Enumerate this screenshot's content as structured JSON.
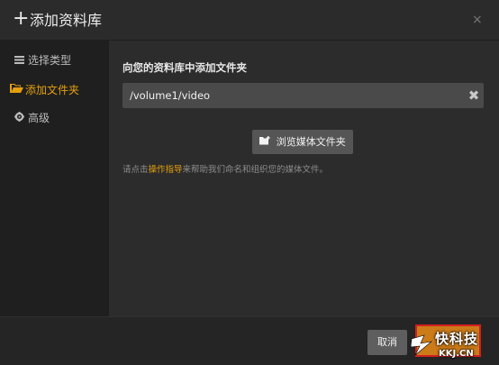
{
  "dialog": {
    "title_icon": "+",
    "title": "添加资料库",
    "close_icon": "×"
  },
  "sidebar": {
    "items": [
      {
        "icon": "list-icon",
        "label": "选择类型",
        "active": false
      },
      {
        "icon": "folder-open-icon",
        "label": "添加文件夹",
        "active": true
      },
      {
        "icon": "gear-icon",
        "label": "高级",
        "active": false
      }
    ]
  },
  "main": {
    "section_label": "向您的资料库中添加文件夹",
    "folder_path": "/volume1/video",
    "clear_icon": "✖",
    "browse_label": "浏览媒体文件夹",
    "hint_prefix": "请点击",
    "hint_link": "操作指导",
    "hint_suffix": "来帮助我们命名和组织您的媒体文件。"
  },
  "footer": {
    "cancel_label": "取消"
  },
  "watermark": {
    "brand": "快科技",
    "domain": "KKJ.CN"
  },
  "colors": {
    "accent": "#e5a00d",
    "primary_button": "#cc7b19",
    "highlight_box": "#d21f1f",
    "background": "#2c2c2c",
    "sidebar": "#1f1f1f"
  }
}
